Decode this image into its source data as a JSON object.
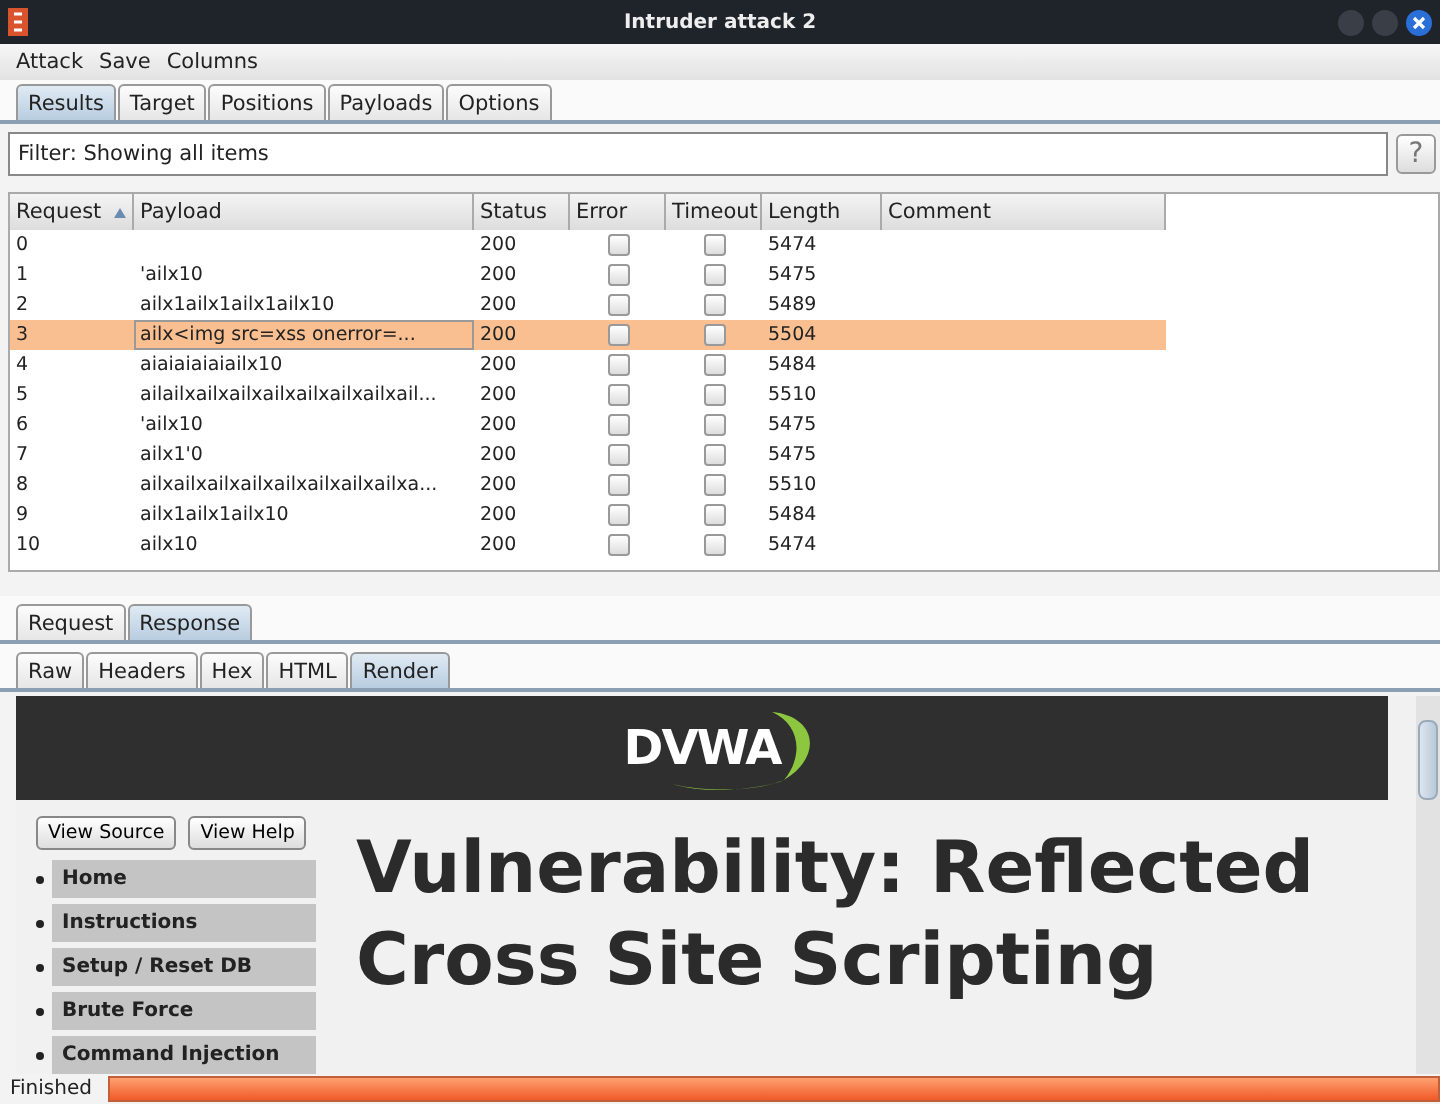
{
  "window": {
    "title": "Intruder attack 2"
  },
  "menu": [
    "Attack",
    "Save",
    "Columns"
  ],
  "tabs": [
    {
      "label": "Results",
      "selected": true
    },
    {
      "label": "Target",
      "selected": false
    },
    {
      "label": "Positions",
      "selected": false
    },
    {
      "label": "Payloads",
      "selected": false
    },
    {
      "label": "Options",
      "selected": false
    }
  ],
  "filter": {
    "text": "Filter: Showing all items",
    "help": "?"
  },
  "table": {
    "columns": [
      {
        "label": "Request",
        "sorted": true
      },
      {
        "label": "Payload",
        "sorted": false
      },
      {
        "label": "Status",
        "sorted": false
      },
      {
        "label": "Error",
        "sorted": false
      },
      {
        "label": "Timeout",
        "sorted": false
      },
      {
        "label": "Length",
        "sorted": false
      },
      {
        "label": "Comment",
        "sorted": false
      }
    ],
    "rows": [
      {
        "request": "0",
        "payload": "",
        "status": "200",
        "error": false,
        "timeout": false,
        "length": "5474",
        "selected": false
      },
      {
        "request": "1",
        "payload": "'ailx10",
        "status": "200",
        "error": false,
        "timeout": false,
        "length": "5475",
        "selected": false
      },
      {
        "request": "2",
        "payload": "ailx1ailx1ailx1ailx10",
        "status": "200",
        "error": false,
        "timeout": false,
        "length": "5489",
        "selected": false
      },
      {
        "request": "3",
        "payload": "ailx<img src=xss onerror=...",
        "status": "200",
        "error": false,
        "timeout": false,
        "length": "5504",
        "selected": true
      },
      {
        "request": "4",
        "payload": "aiaiaiaiaiailx10",
        "status": "200",
        "error": false,
        "timeout": false,
        "length": "5484",
        "selected": false
      },
      {
        "request": "5",
        "payload": "ailailxailxailxailxailxailxailxail...",
        "status": "200",
        "error": false,
        "timeout": false,
        "length": "5510",
        "selected": false
      },
      {
        "request": "6",
        "payload": "'ailx10",
        "status": "200",
        "error": false,
        "timeout": false,
        "length": "5475",
        "selected": false
      },
      {
        "request": "7",
        "payload": "ailx1'0",
        "status": "200",
        "error": false,
        "timeout": false,
        "length": "5475",
        "selected": false
      },
      {
        "request": "8",
        "payload": "ailxailxailxailxailxailxailxailxa...",
        "status": "200",
        "error": false,
        "timeout": false,
        "length": "5510",
        "selected": false
      },
      {
        "request": "9",
        "payload": "ailx1ailx1ailx10",
        "status": "200",
        "error": false,
        "timeout": false,
        "length": "5484",
        "selected": false
      },
      {
        "request": "10",
        "payload": "ailx10",
        "status": "200",
        "error": false,
        "timeout": false,
        "length": "5474",
        "selected": false
      }
    ]
  },
  "message_tabs": [
    {
      "label": "Request",
      "selected": false
    },
    {
      "label": "Response",
      "selected": true
    }
  ],
  "view_tabs": [
    {
      "label": "Raw",
      "selected": false
    },
    {
      "label": "Headers",
      "selected": false
    },
    {
      "label": "Hex",
      "selected": false
    },
    {
      "label": "HTML",
      "selected": false
    },
    {
      "label": "Render",
      "selected": true
    }
  ],
  "render": {
    "logo": "DVWA",
    "buttons": [
      "View Source",
      "View Help"
    ],
    "nav": [
      "Home",
      "Instructions",
      "Setup / Reset DB",
      "Brute Force",
      "Command Injection"
    ],
    "heading": [
      "Vulnerability: Reflected",
      "Cross Site Scripting"
    ]
  },
  "status_bar": {
    "text": "Finished",
    "level": 1
  }
}
